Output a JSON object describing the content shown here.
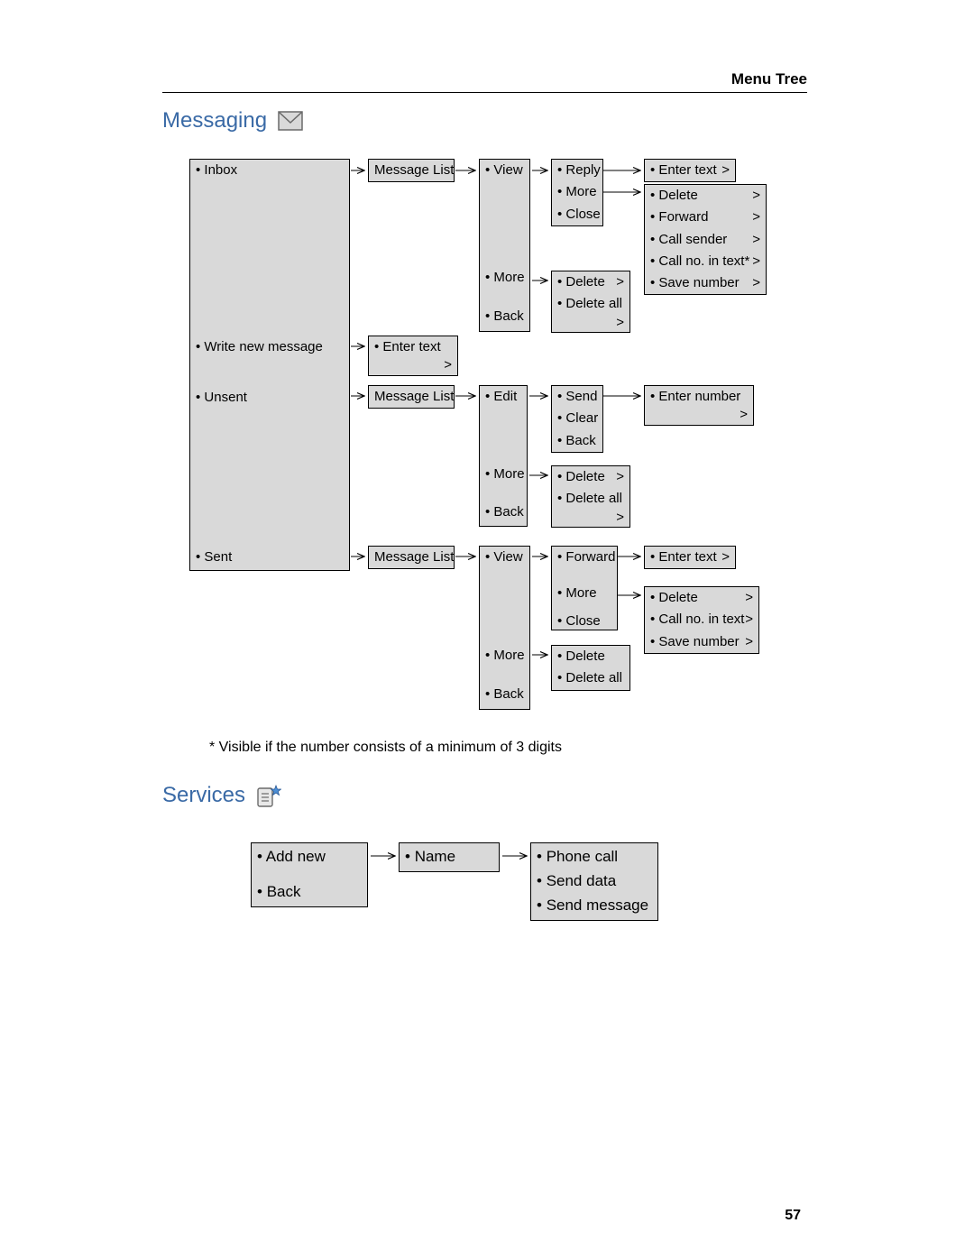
{
  "header": "Menu Tree",
  "page_number": "57",
  "messaging": {
    "title": "Messaging",
    "main": {
      "inbox": "Inbox",
      "write": "Write new message",
      "unsent": "Unsent",
      "sent": "Sent"
    },
    "msg_list": "Message List",
    "enter_text": "Enter text",
    "enter_number": "Enter number",
    "inbox_view": {
      "view": "View",
      "more": "More",
      "back": "Back",
      "reply": "Reply",
      "vmore": "More",
      "close": "Close",
      "reply_enter": "Enter text",
      "more_items": {
        "delete": "Delete",
        "forward": "Forward",
        "call_sender": "Call sender",
        "call_no": "Call no. in text*",
        "save_no": "Save number"
      },
      "more_sub": {
        "delete": "Delete",
        "delete_all": "Delete all"
      }
    },
    "unsent_view": {
      "edit": "Edit",
      "more": "More",
      "back": "Back",
      "send": "Send",
      "clear": "Clear",
      "eback": "Back",
      "more_sub": {
        "delete": "Delete",
        "delete_all": "Delete all"
      }
    },
    "sent_view": {
      "view": "View",
      "more": "More",
      "back": "Back",
      "forward": "Forward",
      "vmore": "More",
      "close": "Close",
      "fwd_enter": "Enter text",
      "more_items": {
        "delete": "Delete",
        "call_no": "Call no. in text",
        "save_no": "Save number"
      },
      "more_sub": {
        "delete": "Delete",
        "delete_all": "Delete all"
      }
    }
  },
  "footnote": "* Visible if the number consists of a minimum of 3 digits",
  "services": {
    "title": "Services",
    "main": {
      "add": "Add new",
      "back": "Back"
    },
    "name": "Name",
    "actions": {
      "phone": "Phone call",
      "data": "Send data",
      "msg": "Send message"
    }
  }
}
